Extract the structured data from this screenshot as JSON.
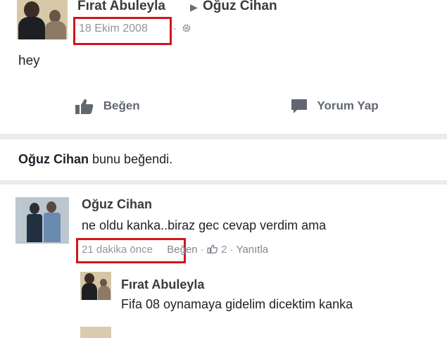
{
  "post": {
    "author": "Fırat Abuleyla",
    "arrow": "▶",
    "target": "Oğuz Cihan",
    "date": "18 Ekim 2008",
    "dot": "·",
    "gear_icon": "gear-icon",
    "text": "hey",
    "actions": {
      "like_label": "Beğen",
      "comment_label": "Yorum Yap"
    }
  },
  "likes": {
    "name": "Oğuz Cihan",
    "suffix": "bunu beğendi."
  },
  "comments": [
    {
      "author": "Oğuz Cihan",
      "text": "ne oldu kanka..biraz gec cevap verdim ama",
      "time": "21 dakika önce",
      "sep": "·",
      "like_label": "Beğen",
      "like_count": "2",
      "reply_label": "Yanıtla"
    }
  ],
  "reply": {
    "author": "Fırat Abuleyla",
    "text": "Fifa 08 oynamaya gidelim dicektim kanka"
  },
  "colors": {
    "highlight": "#d0161b",
    "link": "#365899",
    "meta": "#90949c"
  }
}
